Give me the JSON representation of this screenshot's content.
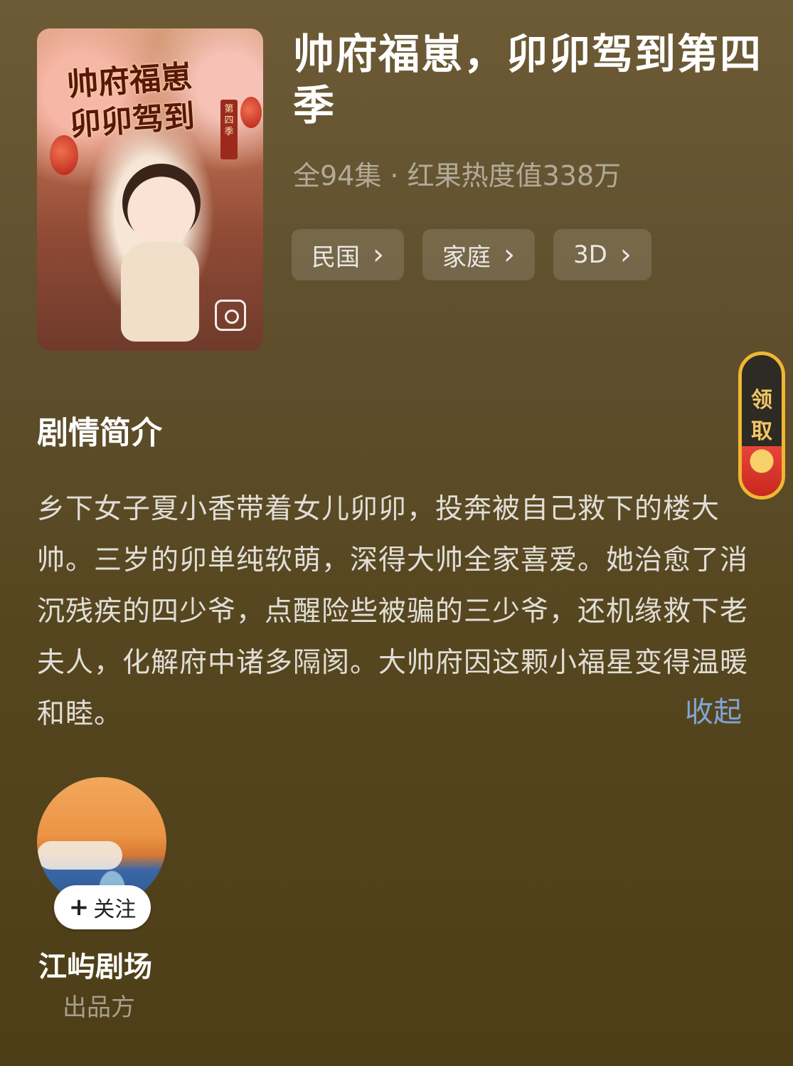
{
  "poster": {
    "title_line1": "帅府福崽",
    "title_line2": "卯卯驾到",
    "badge": "第四季"
  },
  "drama": {
    "title": "帅府福崽，卯卯驾到第四季",
    "meta": "全94集 · 红果热度值338万",
    "tags": [
      {
        "label": "民国"
      },
      {
        "label": "家庭"
      },
      {
        "label": "3D"
      }
    ]
  },
  "claim": {
    "label": "领取"
  },
  "synopsis": {
    "heading": "剧情简介",
    "text": "乡下女子夏小香带着女儿卯卯，投奔被自己救下的楼大帅。三岁的卯单纯软萌，深得大帅全家喜爱。她治愈了消沉残疾的四少爷，点醒险些被骗的三少爷，还机缘救下老夫人，化解府中诸多隔阂。大帅府因这颗小福星变得温暖和睦。",
    "collapse_label": "收起"
  },
  "creator": {
    "follow_plus": "+",
    "follow_label": "关注",
    "name": "江屿剧场",
    "role": "出品方"
  },
  "icons": {
    "tag_chevron": "chevron-right-icon",
    "gallery": "gallery-icon"
  }
}
